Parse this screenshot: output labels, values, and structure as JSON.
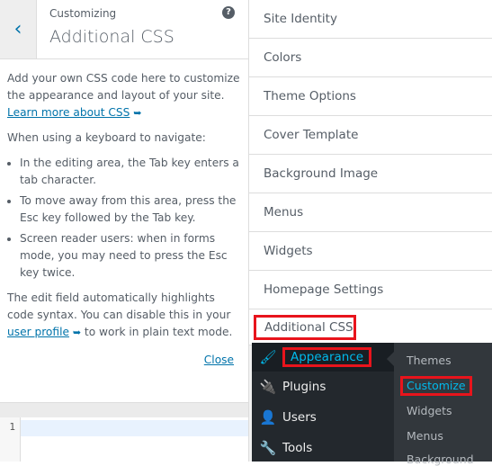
{
  "panel": {
    "subtitle": "Customizing",
    "title": "Additional CSS",
    "back_icon": "chevron-left-icon",
    "help_icon": "question-icon",
    "intro": "Add your own CSS code here to customize the appearance and layout of your site.",
    "learn_link": "Learn more about CSS",
    "keyboard_heading": "When using a keyboard to navigate:",
    "bullets": [
      "In the editing area, the Tab key enters a tab character.",
      "To move away from this area, press the Esc key followed by the Tab key.",
      "Screen reader users: when in forms mode, you may need to press the Esc key twice."
    ],
    "highlight_text_1": "The edit field automatically highlights code syntax. You can disable this in your ",
    "user_profile_link": "user profile",
    "highlight_text_2": " to work in plain text mode.",
    "close_label": "Close",
    "line_number": "1"
  },
  "sections": [
    "Site Identity",
    "Colors",
    "Theme Options",
    "Cover Template",
    "Background Image",
    "Menus",
    "Widgets",
    "Homepage Settings"
  ],
  "additional_css_label": "Additional CSS",
  "admin_menu": {
    "appearance": "Appearance",
    "plugins": "Plugins",
    "users": "Users",
    "tools": "Tools"
  },
  "submenu": {
    "themes": "Themes",
    "customize": "Customize",
    "widgets": "Widgets",
    "menus": "Menus",
    "background": "Background"
  },
  "colors": {
    "highlight_box": "#e8141c",
    "link": "#0073aa",
    "active": "#00b9eb"
  }
}
